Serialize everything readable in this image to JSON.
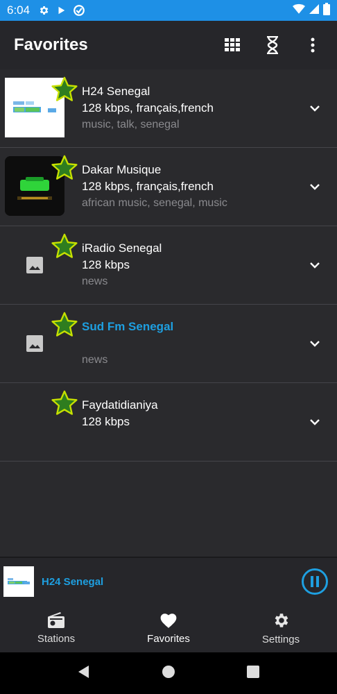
{
  "status_bar": {
    "time": "6:04"
  },
  "app_bar": {
    "title": "Favorites"
  },
  "stations": [
    {
      "name": "H24 Senegal",
      "bitrate": "128 kbps, français,french",
      "tags": "music, talk, senegal",
      "favorite": true,
      "playing": false
    },
    {
      "name": "Dakar Musique",
      "bitrate": "128 kbps, français,french",
      "tags": "african music, senegal, music",
      "favorite": true,
      "playing": false
    },
    {
      "name": "iRadio Senegal",
      "bitrate": "128 kbps",
      "tags": "news",
      "favorite": true,
      "playing": false
    },
    {
      "name": "Sud Fm Senegal",
      "bitrate": "",
      "tags": "news",
      "favorite": true,
      "playing": true
    },
    {
      "name": "Faydatidianiya",
      "bitrate": "128 kbps",
      "tags": "",
      "favorite": true,
      "playing": false
    }
  ],
  "now_playing": {
    "title": "H24 Senegal",
    "state": "playing"
  },
  "bottom_nav": [
    {
      "label": "Stations",
      "icon": "radio-icon",
      "active": false
    },
    {
      "label": "Favorites",
      "icon": "heart-icon",
      "active": true
    },
    {
      "label": "Settings",
      "icon": "gear-icon",
      "active": false
    }
  ],
  "colors": {
    "accent": "#1e9fe0",
    "status_bar": "#1e90e6",
    "star_fill": "#2e7d1f",
    "star_outline": "#c6e000"
  }
}
